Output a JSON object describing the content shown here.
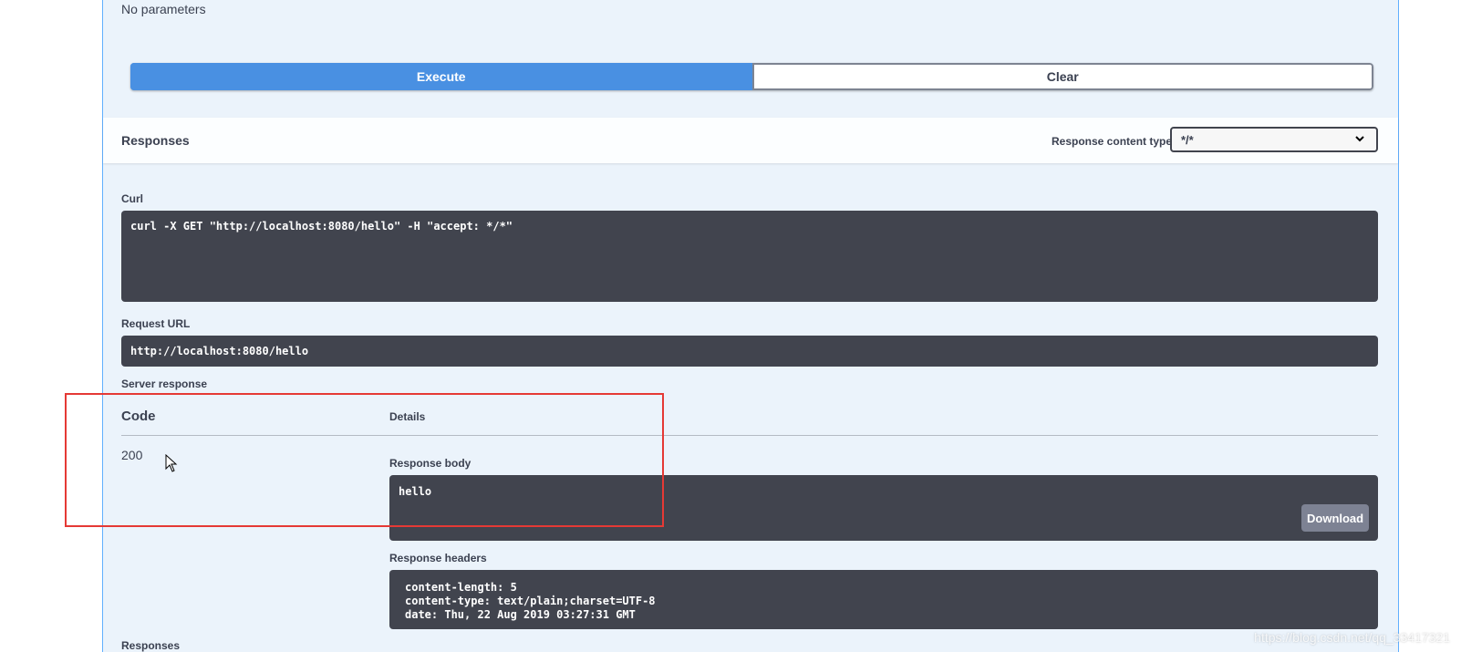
{
  "parameters": {
    "empty_text": "No parameters"
  },
  "buttons": {
    "execute": "Execute",
    "clear": "Clear"
  },
  "responses_bar": {
    "title": "Responses",
    "content_type_label": "Response content type",
    "content_type_value": "*/*"
  },
  "curl": {
    "label": "Curl",
    "command": "curl -X GET \"http://localhost:8080/hello\" -H \"accept: */*\""
  },
  "request_url": {
    "label": "Request URL",
    "value": "http://localhost:8080/hello"
  },
  "server_response": {
    "label": "Server response",
    "code_header": "Code",
    "details_header": "Details",
    "code": "200",
    "response_body_label": "Response body",
    "response_body": "hello",
    "download_label": "Download",
    "response_headers_label": "Response headers",
    "headers": [
      "content-length: 5",
      "content-type: text/plain;charset=UTF-8",
      "date: Thu, 22 Aug 2019 03:27:31 GMT"
    ]
  },
  "footer": {
    "responses_title": "Responses"
  },
  "watermark": "https://blog.csdn.net/qq_33417321",
  "colors": {
    "panel_bg": "#ebf3fb",
    "panel_border": "#61affe",
    "execute_bg": "#4990e2",
    "code_bg": "#41444e",
    "highlight": "#e53935"
  },
  "icons": {
    "select": "chevron-down-icon",
    "cursor": "mouse-pointer-icon"
  }
}
